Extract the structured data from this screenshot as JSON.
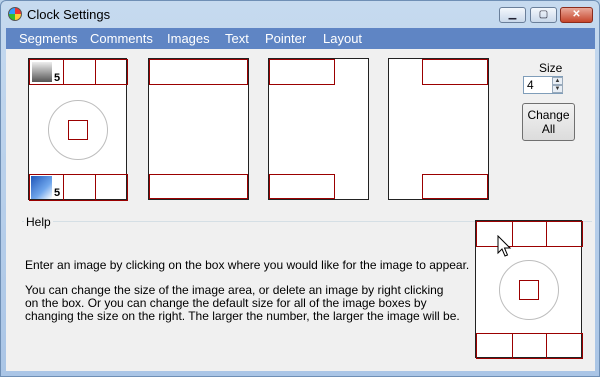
{
  "window": {
    "title": "Clock Settings",
    "icon": "color-wheel-icon"
  },
  "title_buttons": {
    "minimize": "▁",
    "maximize": "▢",
    "close": "✕"
  },
  "menu": [
    "Segments",
    "Comments",
    "Images",
    "Text",
    "Pointer",
    "Layout"
  ],
  "panels": [
    {
      "name": "layout-full",
      "top_badge": "5",
      "bottom_badge": "5"
    },
    {
      "name": "layout-top-bottom"
    },
    {
      "name": "layout-top-left"
    },
    {
      "name": "layout-right"
    }
  ],
  "size": {
    "label": "Size",
    "value": "4"
  },
  "change_all_button": {
    "line1": "Change",
    "line2": "All"
  },
  "help": {
    "label": "Help",
    "lines": [
      "Enter an image by clicking on the box where you would like for the image to appear.",
      "You can change the size of the image area, or delete an image by right clicking",
      "on the box. Or you can change the default size for all of the image boxes by",
      "changing the size on the right.  The larger the number, the larger the image will be."
    ]
  },
  "colors": {
    "menubar": "#5f85c4",
    "box_border": "#9b0000",
    "close_button": "#c6452b"
  }
}
